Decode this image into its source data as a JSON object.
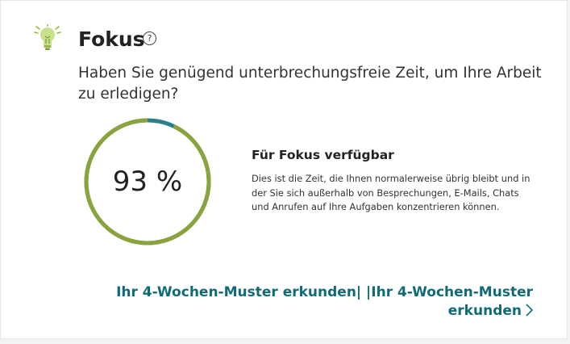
{
  "card": {
    "title": "Fokus",
    "help_glyph": "?",
    "question": "Haben Sie genügend unterbrechungsfreie Zeit, um Ihre Arbeit zu erledigen?",
    "focus_percent": 93,
    "focus_percent_label": "93 %",
    "info_title": "Für Fokus verfügbar",
    "info_description": "Dies ist die Zeit, die Ihnen normalerweise übrig bleibt und in der Sie sich außerhalb von Besprechungen, E-Mails, Chats und Anrufen auf Ihre Aufgaben konzentrieren können.",
    "link_label": "Ihr 4-Wochen-Muster erkunden| |Ihr 4-Wochen-Muster erkunden"
  },
  "icons": {
    "bulb": "lightbulb-icon",
    "help": "help-icon",
    "chevron": "chevron-right-icon"
  },
  "colors": {
    "focus": "#8aa43b",
    "other": "#2a7f8c",
    "link": "#0f6b78",
    "bulb": "#c7e28a"
  }
}
